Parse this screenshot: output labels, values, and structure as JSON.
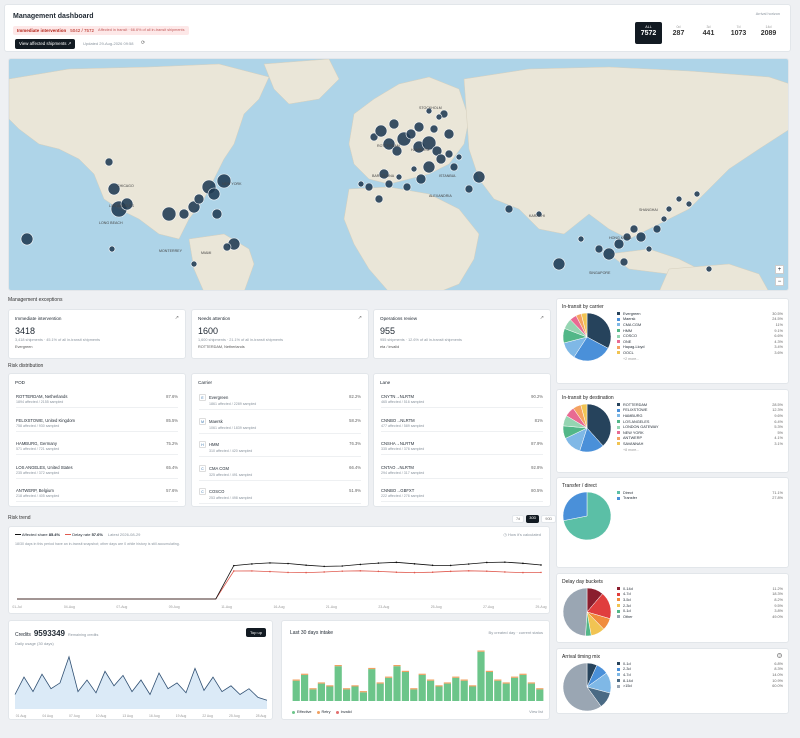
{
  "header": {
    "title": "Management dashboard",
    "alert_label": "Immediate intervention",
    "alert_count": "5042 / 7572",
    "alert_note": "Affected in transit · 66.6% of all in-transit shipments",
    "view_button": "View affected shipments",
    "updated": "Updated 29-Aug-2026 09:58",
    "arrival_label": "Arrival horizon",
    "horizons": [
      {
        "label": "ALL",
        "value": "7572",
        "active": true
      },
      {
        "label": "0d",
        "value": "287",
        "active": false
      },
      {
        "label": "3d",
        "value": "441",
        "active": false
      },
      {
        "label": "7d",
        "value": "1073",
        "active": false
      },
      {
        "label": "14d",
        "value": "2089",
        "active": false
      }
    ]
  },
  "map": {
    "cities": [
      "CHICAGO",
      "NEW YORK",
      "MIAMI",
      "LOS ANGELES",
      "MONTERREY",
      "STOCKHOLM",
      "HAMBURG",
      "ROTTERDAM",
      "BARCELONA",
      "ISTANBUL",
      "ALEXANDRIA",
      "KARACHI",
      "SHANGHAI",
      "HONG KONG",
      "SINGAPORE",
      "LONG BEACH"
    ],
    "zoom_in": "+",
    "zoom_out": "−"
  },
  "exceptions": {
    "section": "Management exceptions",
    "cards": [
      {
        "title": "Immediate intervention",
        "value": "3418",
        "sub": "3,418 shipments · 45.1% of all in-transit shipments",
        "top": "Evergreen"
      },
      {
        "title": "Needs attention",
        "value": "1600",
        "sub": "1,600 shipments · 21.1% of all in-transit shipments",
        "top": "ROTTERDAM, Netherlands"
      },
      {
        "title": "Operations review",
        "value": "955",
        "sub": "955 shipments · 12.6% of all in-transit shipments",
        "top": "eta / invalid"
      }
    ]
  },
  "risk_distribution": {
    "section": "Risk distribution",
    "columns": [
      {
        "title": "POD",
        "rows": [
          {
            "name": "ROTTERDAM, Netherlands",
            "pct": "87.6%",
            "sub": "1894 affected / 2155 sampled"
          },
          {
            "name": "FELIXSTOWE, United Kingdom",
            "pct": "85.5%",
            "sub": "758 affected / 930 sampled"
          },
          {
            "name": "HAMBURG, Germany",
            "pct": "75.2%",
            "sub": "571 affected / 721 sampled"
          },
          {
            "name": "LOS ANGELES, United States",
            "pct": "65.4%",
            "sub": "235 affected / 372 sampled"
          },
          {
            "name": "ANTWERP, Belgium",
            "pct": "57.6%",
            "sub": "218 affected / 405 sampled"
          }
        ]
      },
      {
        "title": "Carrier",
        "rows": [
          {
            "name": "Evergreen",
            "pct": "82.2%",
            "sub": "1861 affected / 2289 sampled",
            "icon": "E"
          },
          {
            "name": "Maersk",
            "pct": "58.2%",
            "sub": "1061 affected / 1839 sampled",
            "icon": "M"
          },
          {
            "name": "HMM",
            "pct": "76.3%",
            "sub": "310 affected / 420 sampled",
            "icon": "H"
          },
          {
            "name": "CMA CGM",
            "pct": "66.4%",
            "sub": "325 affected / 491 sampled",
            "icon": "C"
          },
          {
            "name": "COSCO",
            "pct": "51.9%",
            "sub": "253 affected / 498 sampled",
            "icon": "C"
          }
        ]
      },
      {
        "title": "Lane",
        "rows": [
          {
            "name": "CNYTN→NLRTM",
            "pct": "90.2%",
            "sub": "465 affected / 516 sampled"
          },
          {
            "name": "CNNBO→NLRTM",
            "pct": "81%",
            "sub": "477 affected / 589 sampled"
          },
          {
            "name": "CNSHA→NLRTM",
            "pct": "87.9%",
            "sub": "335 affected / 376 sampled"
          },
          {
            "name": "CNTAO→NLRTM",
            "pct": "92.8%",
            "sub": "294 affected / 317 sampled"
          },
          {
            "name": "CNNBO→GBFXT",
            "pct": "80.5%",
            "sub": "222 affected / 276 sampled"
          }
        ]
      }
    ]
  },
  "risk_trend": {
    "section": "Risk trend",
    "ranges": [
      "7d",
      "30D",
      "90D"
    ],
    "active_range": "30D",
    "legend_affected": "Affected share",
    "legend_affected_val": "85.4%",
    "legend_delay": "Delay rate",
    "legend_delay_val": "57.6%",
    "latest": "Latest 2026-08-29",
    "how": "How it's calculated",
    "note": "18/30 days in this period have an in-transit snapshot; other days are 0 while history is still accumulating.",
    "x_labels": [
      "01-Jul",
      "04-Aug",
      "07-Aug",
      "09-Aug",
      "11-Aug",
      "16-Aug",
      "21-Aug",
      "23-Aug",
      "25-Aug",
      "27-Aug",
      "29-Aug"
    ]
  },
  "credits": {
    "label": "Credits",
    "value": "9593349",
    "remaining": "Remaining credits",
    "topup": "Top up",
    "usage": "Daily usage (30 days)",
    "x_labels": [
      "01 Aug",
      "04 Aug",
      "07 Aug",
      "10 Aug",
      "13 Aug",
      "16 Aug",
      "19 Aug",
      "22 Aug",
      "25 Aug",
      "28 Aug"
    ]
  },
  "intake": {
    "title": "Last 30 days intake",
    "mode": "By created day · current status",
    "legend": [
      {
        "name": "Effective",
        "color": "#6cc58a"
      },
      {
        "name": "Retry",
        "color": "#f0a060"
      },
      {
        "name": "Invalid",
        "color": "#e26d6d"
      }
    ],
    "view_list": "View list"
  },
  "donuts": [
    {
      "title": "In-transit by carrier",
      "items": [
        {
          "name": "Evergreen",
          "pct": "30.5%",
          "color": "#26435c"
        },
        {
          "name": "Maersk",
          "pct": "24.5%",
          "color": "#4a90d9"
        },
        {
          "name": "CMA CGM",
          "pct": "11%",
          "color": "#7fb8e6"
        },
        {
          "name": "HMM",
          "pct": "9.1%",
          "color": "#52b788"
        },
        {
          "name": "COSCO",
          "pct": "6.6%",
          "color": "#95d5b2"
        },
        {
          "name": "ONE",
          "pct": "4.3%",
          "color": "#e86a92"
        },
        {
          "name": "Hapag-Lloyd",
          "pct": "3.4%",
          "color": "#f4a261"
        },
        {
          "name": "OOCL",
          "pct": "3.6%",
          "color": "#f1c453"
        }
      ],
      "more": "+2 more..."
    },
    {
      "title": "In-transit by destination",
      "items": [
        {
          "name": "ROTTERDAM",
          "pct": "28.5%",
          "color": "#26435c"
        },
        {
          "name": "FELIXSTOWE",
          "pct": "12.3%",
          "color": "#4a90d9"
        },
        {
          "name": "HAMBURG",
          "pct": "9.6%",
          "color": "#7fb8e6"
        },
        {
          "name": "LOS ANGELES",
          "pct": "6.4%",
          "color": "#52b788"
        },
        {
          "name": "LONDON GATEWAY",
          "pct": "5.3%",
          "color": "#95d5b2"
        },
        {
          "name": "NEW YORK",
          "pct": "5%",
          "color": "#e86a92"
        },
        {
          "name": "ANTWERP",
          "pct": "4.1%",
          "color": "#f4a261"
        },
        {
          "name": "SAVANNAH",
          "pct": "3.1%",
          "color": "#f1c453"
        }
      ],
      "more": "+8 more..."
    },
    {
      "title": "Transfer / direct",
      "items": [
        {
          "name": "Direct",
          "pct": "71.1%",
          "color": "#5bbfa6"
        },
        {
          "name": "Transfer",
          "pct": "27.8%",
          "color": "#4a90d9"
        }
      ],
      "more": ""
    },
    {
      "title": "Delay day buckets",
      "items": [
        {
          "name": "0-14d",
          "pct": "11.2%",
          "color": "#8b1e2e"
        },
        {
          "name": "4-7d",
          "pct": "18.3%",
          "color": "#e03e3e"
        },
        {
          "name": "3-5d",
          "pct": "8.2%",
          "color": "#f08c3c"
        },
        {
          "name": "2-3d",
          "pct": "9.5%",
          "color": "#f1c453"
        },
        {
          "name": "0-1d",
          "pct": "3.8%",
          "color": "#52b788"
        },
        {
          "name": "Other",
          "pct": "49.0%",
          "color": "#9aa6b3"
        }
      ],
      "more": ""
    },
    {
      "title": "Arrival timing mix",
      "items": [
        {
          "name": "0-1d",
          "pct": "6.8%",
          "color": "#26435c"
        },
        {
          "name": "2-3d",
          "pct": "8.3%",
          "color": "#4a90d9"
        },
        {
          "name": "4-7d",
          "pct": "14.0%",
          "color": "#7fb8e6"
        },
        {
          "name": "8-14d",
          "pct": "10.9%",
          "color": "#4a6a84"
        },
        {
          "name": ">15d",
          "pct": "60.0%",
          "color": "#9aa6b3"
        }
      ],
      "more": ""
    }
  ]
}
